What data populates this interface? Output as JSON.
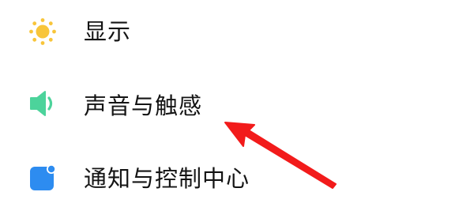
{
  "settings": {
    "items": [
      {
        "label": "显示",
        "icon": "sun-icon",
        "icon_color": "#F8C53A"
      },
      {
        "label": "声音与触感",
        "icon": "speaker-icon",
        "icon_color": "#4CD39B"
      },
      {
        "label": "通知与控制中心",
        "icon": "notification-icon",
        "icon_color": "#2D8CF0"
      }
    ]
  },
  "annotation": {
    "arrow": "pointer-arrow-icon",
    "color": "#F21B1B",
    "target": "声音与触感"
  }
}
